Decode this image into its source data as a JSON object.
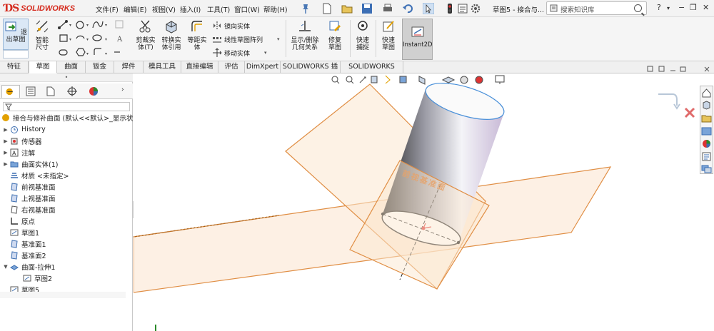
{
  "app": {
    "brand": "SOLIDWORKS",
    "document_title": "草图5 - 接合与..."
  },
  "menu": [
    "文件(F)",
    "编辑(E)",
    "视图(V)",
    "插入(I)",
    "工具(T)",
    "窗口(W)",
    "帮助(H)"
  ],
  "search": {
    "placeholder": "搜索知识库"
  },
  "commands": {
    "exit_sketch": "退出草图",
    "smart_dim": "智能尺寸",
    "trim": "剪裁实体(T)",
    "convert": "转换实体引用",
    "offset": "等距实体",
    "mirror": "镜向实体",
    "linear_pattern": "线性草图阵列",
    "move": "移动实体",
    "show_delete_rel": "显示/删除几何关系",
    "repair_sketch": "修复草图",
    "quick_snap": "快速捕捉",
    "rapid_sketch": "快速草图",
    "instant2d": "Instant2D"
  },
  "tabs": [
    "特征",
    "草图",
    "曲面",
    "钣金",
    "焊件",
    "模具工具",
    "直接编辑",
    "评估",
    "DimXpert",
    "SOLIDWORKS 插件",
    "SOLIDWORKS MBD"
  ],
  "active_tab": "草图",
  "tree": {
    "root": "接合与修补曲面  (默认<<默认>_显示状",
    "items": [
      {
        "label": "History",
        "expandable": true
      },
      {
        "label": "传感器",
        "expandable": true
      },
      {
        "label": "注解",
        "expandable": true
      },
      {
        "label": "曲面实体(1)",
        "expandable": true
      },
      {
        "label": "材质 <未指定>",
        "expandable": false
      },
      {
        "label": "前视基准面",
        "expandable": false
      },
      {
        "label": "上视基准面",
        "expandable": false
      },
      {
        "label": "右视基准面",
        "expandable": false
      },
      {
        "label": "原点",
        "expandable": false
      },
      {
        "label": "草图1",
        "expandable": false
      },
      {
        "label": "基准面1",
        "expandable": false
      },
      {
        "label": "基准面2",
        "expandable": false
      },
      {
        "label": "曲面-拉伸1",
        "expandable": true,
        "expanded": true
      },
      {
        "label": "草图2",
        "expandable": false,
        "child": true
      },
      {
        "label": "草图5",
        "expandable": false
      }
    ]
  },
  "viewport": {
    "plane_label": "前视基准面"
  },
  "colors": {
    "plane": "#e59a4a",
    "plane_fill": "#fbe7d0",
    "cylinder_edge": "#4a90d9",
    "brand_red": "#d52b1e"
  }
}
